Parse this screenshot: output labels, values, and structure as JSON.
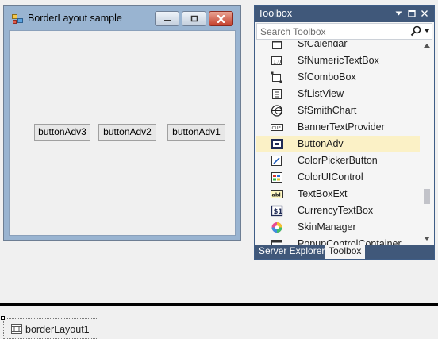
{
  "form": {
    "title": "BorderLayout sample",
    "buttons": [
      "buttonAdv3",
      "buttonAdv2",
      "buttonAdv1"
    ]
  },
  "toolbox": {
    "title": "Toolbox",
    "search_placeholder": "Search Toolbox",
    "items": [
      {
        "label": "SfCalendar",
        "icon": "calendar-icon"
      },
      {
        "label": "SfNumericTextBox",
        "icon": "numeric-textbox-icon"
      },
      {
        "label": "SfComboBox",
        "icon": "combobox-icon"
      },
      {
        "label": "SfListView",
        "icon": "listview-icon"
      },
      {
        "label": "SfSmithChart",
        "icon": "smith-chart-icon"
      },
      {
        "label": "BannerTextProvider",
        "icon": "banner-text-icon"
      },
      {
        "label": "ButtonAdv",
        "icon": "button-adv-icon",
        "selected": true
      },
      {
        "label": "ColorPickerButton",
        "icon": "color-picker-icon"
      },
      {
        "label": "ColorUIControl",
        "icon": "color-ui-icon"
      },
      {
        "label": "TextBoxExt",
        "icon": "textbox-ext-icon"
      },
      {
        "label": "CurrencyTextBox",
        "icon": "currency-textbox-icon"
      },
      {
        "label": "SkinManager",
        "icon": "skin-manager-icon"
      },
      {
        "label": "PopupControlContainer",
        "icon": "popup-container-icon"
      }
    ],
    "tabs": {
      "server_explorer": "Server Explorer",
      "toolbox": "Toolbox"
    }
  },
  "tray": {
    "component": "borderLayout1"
  },
  "colors": {
    "toolbox_header": "#40587a",
    "selection": "#fbf1c6",
    "form_frame": "#99b4d1"
  }
}
